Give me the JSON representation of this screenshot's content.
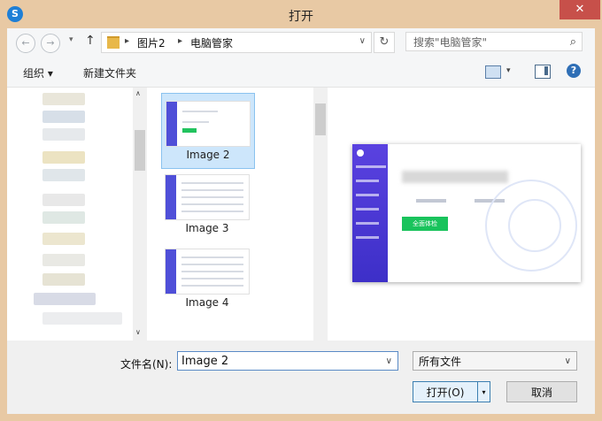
{
  "window": {
    "title": "打开",
    "app_icon": "sogou-icon",
    "close_glyph": "✕"
  },
  "nav": {
    "back_glyph": "←",
    "forward_glyph": "→",
    "recent_glyph": "▾",
    "up_glyph": "↑",
    "breadcrumbs": [
      "图片2",
      "电脑管家"
    ],
    "crumb_sep": "▸",
    "address_drop": "∨",
    "refresh_glyph": "↻",
    "search_placeholder": "搜索\"电脑管家\"",
    "search_glyph": "⌕"
  },
  "toolbar": {
    "organize_label": "组织 ▾",
    "new_folder_label": "新建文件夹",
    "view_drop": "▾",
    "help_glyph": "?"
  },
  "files": [
    {
      "label": "Image 2",
      "selected": true
    },
    {
      "label": "Image 3",
      "selected": false
    },
    {
      "label": "Image 4",
      "selected": false
    }
  ],
  "preview": {
    "button_label": "全面体检",
    "accent": "#19c35c",
    "sidebar_color": "#4b3ad8"
  },
  "bottom": {
    "filename_label": "文件名(N):",
    "filename_value": "Image 2",
    "filetype_value": "所有文件",
    "open_label": "打开(O)",
    "cancel_label": "取消",
    "dropdown_glyph": "▾"
  },
  "scroll": {
    "up_glyph": "∧",
    "down_glyph": "∨"
  }
}
